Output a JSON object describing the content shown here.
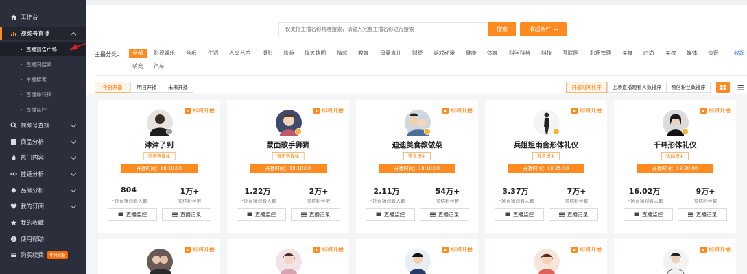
{
  "sidebar": {
    "items": [
      {
        "label": "工作台",
        "icon": "home-icon"
      },
      {
        "label": "视频号直播",
        "icon": "bar-chart-icon"
      },
      {
        "label": "视频号查找",
        "icon": "search-icon"
      },
      {
        "label": "商品分析",
        "icon": "shop-icon"
      },
      {
        "label": "热门内容",
        "icon": "fire-icon"
      },
      {
        "label": "挂链分析",
        "icon": "link-icon"
      },
      {
        "label": "品牌分析",
        "icon": "brand-icon"
      },
      {
        "label": "我的订阅",
        "icon": "heart-icon"
      },
      {
        "label": "我的收藏",
        "icon": "star-icon"
      },
      {
        "label": "使用帮助",
        "icon": "help-icon"
      },
      {
        "label": "购买续费",
        "icon": "cart-icon",
        "badge": "年付钜折"
      }
    ],
    "sub_items": [
      "直播预告广场",
      "直播间搜索",
      "主播搜索",
      "直播排行榜",
      "直播监控"
    ]
  },
  "search": {
    "placeholder": "仅支持主播名称精准搜索，请输入完整主播名称进行搜索",
    "button": "搜索",
    "collapse": "收起条件"
  },
  "categories": {
    "label": "主播分类：",
    "items": [
      "全部",
      "影视娱乐",
      "音乐",
      "生活",
      "人文艺术",
      "摄影",
      "旅游",
      "搞笑趣闻",
      "情感",
      "教育",
      "母婴育儿",
      "财经",
      "游戏动漫",
      "健康",
      "体育",
      "科学科普",
      "科技",
      "互联网",
      "职场管理",
      "美食",
      "时尚",
      "美妆",
      "媒体",
      "资讯"
    ],
    "items2": [
      "萌宠",
      "汽车"
    ],
    "more": "收起"
  },
  "filters": {
    "days": [
      "今日开播",
      "明日开播",
      "未来开播"
    ],
    "sorts": [
      "开播时间排序",
      "上场直播观看人数排序",
      "预估粉丝数排序"
    ]
  },
  "labels": {
    "soon": "即将开播",
    "watchers": "上场直播观看人数",
    "fans": "预估粉丝数",
    "monitor": "直播监控",
    "records": "直播记录"
  },
  "cards": [
    {
      "name": "津津了到",
      "tag": "情感自媒体",
      "time": "开播时间：18:10:00",
      "watchers": "804",
      "fans": "1万+"
    },
    {
      "name": "蒙面歌手狮狮",
      "tag": "音乐自媒体",
      "time": "开播时间：18:10:00",
      "watchers": "1.22万",
      "fans": "2万+"
    },
    {
      "name": "迪迪美食教做菜",
      "tag": "美食博主",
      "time": "开播时间：18:10:00",
      "watchers": "2.11万",
      "fans": "54万+"
    },
    {
      "name": "兵姐姐雨含形体礼仪",
      "tag": "教育博主",
      "time": "开播时间：18:25:00",
      "watchers": "3.37万",
      "fans": "7万+"
    },
    {
      "name": "千玮形体礼仪",
      "tag": "运动博主",
      "time": "开播时间：18:20:00",
      "watchers": "16.02万",
      "fans": "9万+"
    }
  ],
  "colors": {
    "accent": "#ff8a1f",
    "sidebar": "#2b2e3b"
  }
}
